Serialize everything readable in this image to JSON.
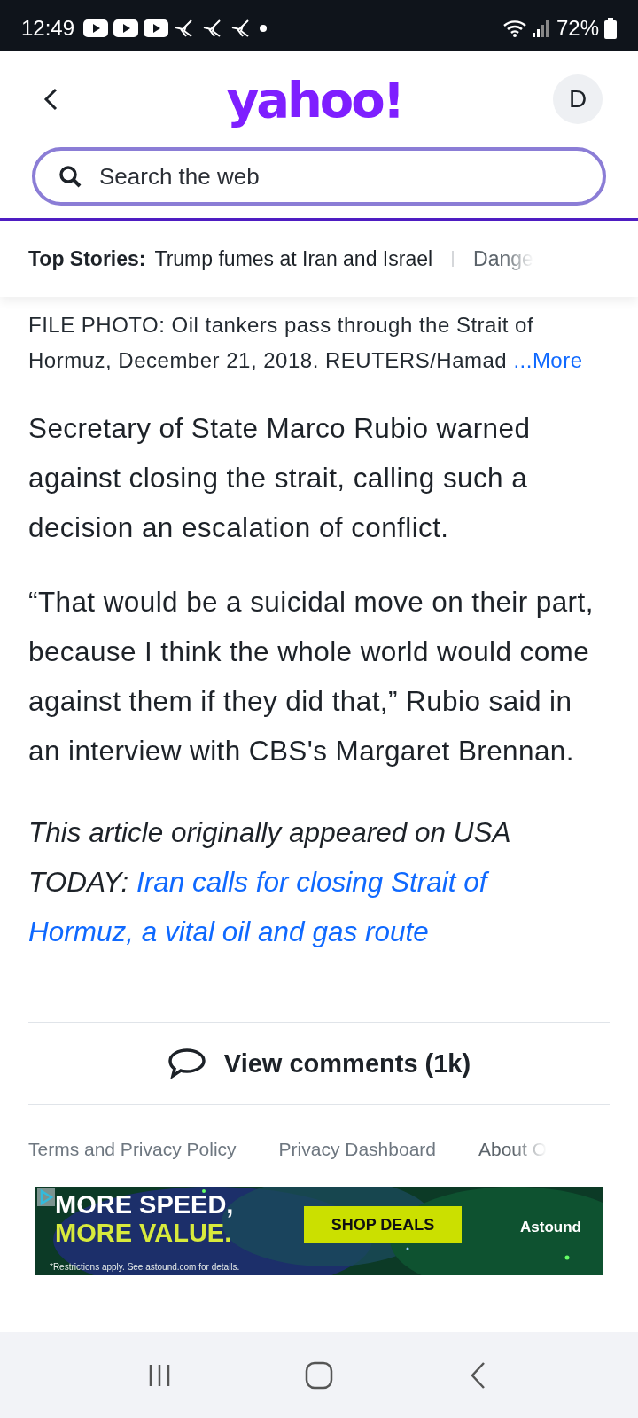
{
  "status_bar": {
    "time": "12:49",
    "battery": "72%"
  },
  "header": {
    "logo": "yahoo!",
    "avatar": "D",
    "search": {
      "placeholder": "Search the web"
    }
  },
  "top_stories": {
    "label": "Top Stories:",
    "items": [
      "Trump fumes at Iran and Israel",
      "Dange"
    ]
  },
  "caption": {
    "text": "FILE PHOTO: Oil tankers pass through the Strait of Hormuz, December 21, 2018. REUTERS/Hamad",
    "more": "...More"
  },
  "paragraphs": [
    "Secretary of State Marco Rubio warned against closing the strait, calling such a decision an escalation of conflict.",
    "“That would be a suicidal move on their part, because I think the whole world would come against them if they did that,” Rubio said in an interview with CBS's Margaret Brennan."
  ],
  "attribution": {
    "text": "This article originally appeared on USA TODAY:",
    "link_lines": [
      "Iran calls for closing Strait of",
      "Hormuz, a vital oil and gas route"
    ]
  },
  "comments_button": "View comments (1k)",
  "footer_links": [
    "Terms and Privacy Policy",
    "Privacy Dashboard",
    "About O"
  ],
  "ad": {
    "line1": "MORE SPEED,",
    "line2": "MORE VALUE.",
    "fine_print": "*Restrictions apply. See astound.com for details.",
    "button": "SHOP DEALS",
    "brand": "Astound"
  }
}
